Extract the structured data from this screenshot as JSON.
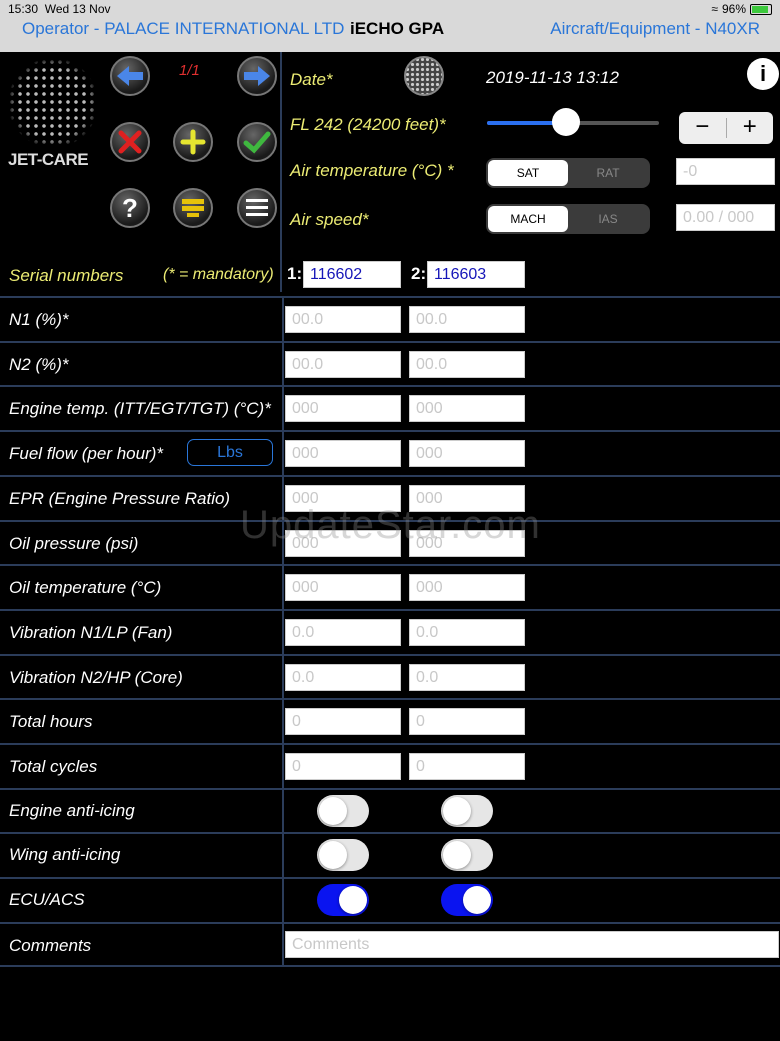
{
  "status_bar": {
    "time": "15:30",
    "date": "Wed 13 Nov",
    "battery": "96%"
  },
  "nav": {
    "operator": "Operator - PALACE INTERNATIONAL LTD",
    "app_title": "iECHO GPA",
    "aircraft": "Aircraft/Equipment - N40XR"
  },
  "logo_text": "JET-CARE",
  "page_indicator": "1/1",
  "toolbar": {
    "prev_icon": "arrow-left-icon",
    "next_icon": "arrow-right-icon",
    "delete_icon": "close-icon",
    "add_icon": "plus-icon",
    "confirm_icon": "checkmark-icon",
    "help_label": "?",
    "stack_icon": "stack-icon",
    "menu_icon": "menu-icon"
  },
  "header": {
    "date_label": "Date*",
    "date_value": "2019-11-13 13:12",
    "info_label": "i",
    "fl_label": "FL 242 (24200 feet)*",
    "fl_slider": 0.46,
    "stepper_minus": "−",
    "stepper_plus": "+",
    "air_temp_label": "Air temperature (°C) *",
    "air_temp_options": [
      "SAT",
      "RAT"
    ],
    "air_temp_selected": "SAT",
    "air_temp_placeholder": "-0",
    "air_speed_label": "Air speed*",
    "air_speed_options": [
      "MACH",
      "IAS"
    ],
    "air_speed_selected": "MACH",
    "air_speed_placeholder": "0.00 / 000"
  },
  "serial": {
    "label": "Serial numbers",
    "mandatory_note": "(* = mandatory)",
    "engine1_tag": "1:",
    "engine1_value": "116602",
    "engine2_tag": "2:",
    "engine2_value": "116603"
  },
  "rows": [
    {
      "label": "N1 (%)*",
      "placeholder": "00.0"
    },
    {
      "label": "N2 (%)*",
      "placeholder": "00.0"
    },
    {
      "label": "Engine temp. (ITT/EGT/TGT) (°C)*",
      "placeholder": "000"
    },
    {
      "label": "Fuel flow (per hour)*",
      "placeholder": "000",
      "unit_button": "Lbs"
    },
    {
      "label": "EPR (Engine Pressure Ratio)",
      "placeholder": "000"
    },
    {
      "label": "Oil pressure (psi)",
      "placeholder": "000"
    },
    {
      "label": "Oil temperature (°C)",
      "placeholder": "000"
    },
    {
      "label": "Vibration N1/LP (Fan)",
      "placeholder": "0.0"
    },
    {
      "label": "Vibration N2/HP (Core)",
      "placeholder": "0.0"
    },
    {
      "label": "Total hours",
      "placeholder": "0"
    },
    {
      "label": "Total cycles",
      "placeholder": "0"
    }
  ],
  "toggles": [
    {
      "label": "Engine anti-icing",
      "engine1": false,
      "engine2": false
    },
    {
      "label": "Wing anti-icing",
      "engine1": false,
      "engine2": false
    },
    {
      "label": "ECU/ACS",
      "engine1": true,
      "engine2": true
    }
  ],
  "comments": {
    "label": "Comments",
    "placeholder": "Comments"
  },
  "watermark": "UpdateStar.com",
  "colors": {
    "accent": "#2a76d8",
    "label_yellow": "#ecec74",
    "toggle_on": "#0a14f0",
    "divider": "#2b3c5a"
  }
}
